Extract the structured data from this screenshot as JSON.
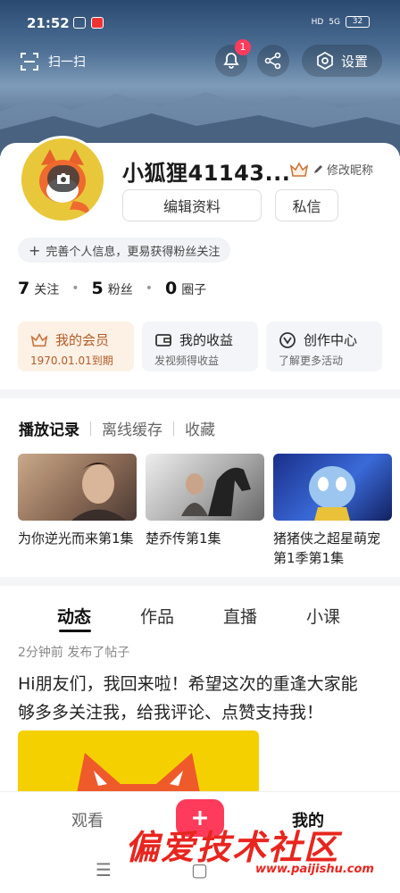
{
  "status": {
    "time": "21:52",
    "signal": "5G",
    "battery": "32"
  },
  "topbar": {
    "scan_label": "扫一扫",
    "notification_count": "1",
    "settings_label": "设置"
  },
  "profile": {
    "username": "小狐狸41143...",
    "edit_nickname": "修改昵称",
    "edit_profile": "编辑资料",
    "message": "私信",
    "tip": "完善个人信息，更易获得粉丝关注"
  },
  "stats": [
    {
      "num": "7",
      "label": "关注"
    },
    {
      "num": "5",
      "label": "粉丝"
    },
    {
      "num": "0",
      "label": "圈子"
    }
  ],
  "features": [
    {
      "title": "我的会员",
      "sub": "1970.01.01到期"
    },
    {
      "title": "我的收益",
      "sub": "发视频得收益"
    },
    {
      "title": "创作中心",
      "sub": "了解更多活动"
    }
  ],
  "history_tabs": [
    "播放记录",
    "离线缓存",
    "收藏"
  ],
  "history": [
    {
      "title": "为你逆光而来第1集"
    },
    {
      "title": "楚乔传第1集"
    },
    {
      "title_line1": "猪猪侠之超星萌宠",
      "title_line2": "第1季第1集"
    }
  ],
  "content_tabs": [
    "动态",
    "作品",
    "直播",
    "小课"
  ],
  "post": {
    "meta": "2分钟前 发布了帖子",
    "line1": "Hi朋友们，我回来啦！希望这次的重逢大家能",
    "line2": "够多多关注我，给我评论、点赞支持我！"
  },
  "bottom_nav": {
    "watch": "观看",
    "mine": "我的"
  },
  "watermark": {
    "text": "偏爱技术社区",
    "url": "www.paijishu.com"
  },
  "colors": {
    "accent": "#ff3b5c",
    "vip": "#c9743a"
  }
}
